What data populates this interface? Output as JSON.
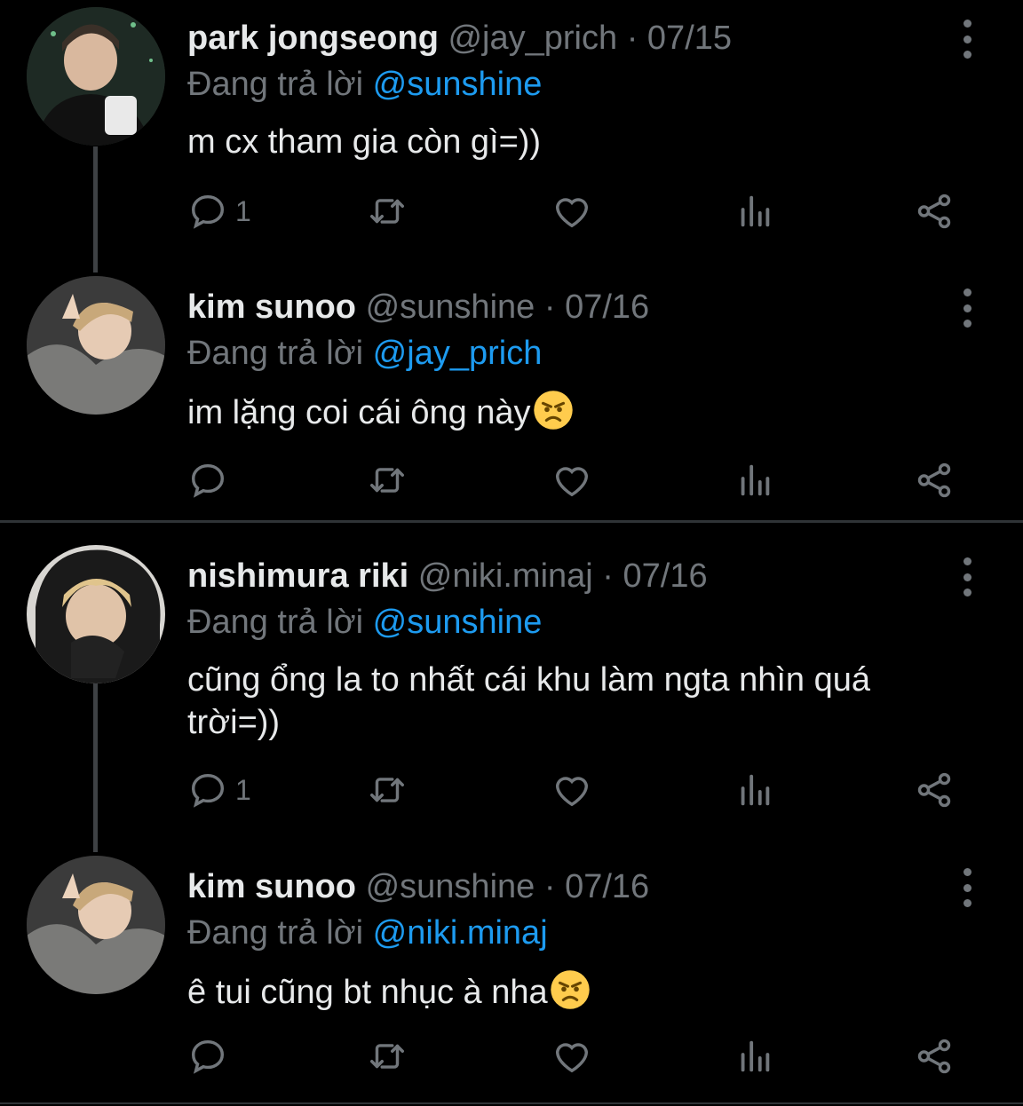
{
  "tweets": [
    {
      "name": "park jongseong",
      "handle": "@jay_prich",
      "separator": "·",
      "date": "07/15",
      "reply_prefix": "Đang trả lời",
      "reply_to": "@sunshine",
      "text": "m cx tham gia còn gì=))",
      "emoji": "",
      "reply_count": "1"
    },
    {
      "name": "kim sunoo",
      "handle": "@sunshine",
      "separator": "·",
      "date": "07/16",
      "reply_prefix": "Đang trả lời",
      "reply_to": "@jay_prich",
      "text": "im lặng coi cái ông này",
      "emoji": "angry-face",
      "reply_count": ""
    },
    {
      "name": "nishimura riki",
      "handle": "@niki.minaj",
      "separator": "·",
      "date": "07/16",
      "reply_prefix": "Đang trả lời",
      "reply_to": "@sunshine",
      "text": "cũng ổng la to nhất cái khu làm ngta nhìn quá trời=))",
      "emoji": "",
      "reply_count": "1"
    },
    {
      "name": "kim sunoo",
      "handle": "@sunshine",
      "separator": "·",
      "date": "07/16",
      "reply_prefix": "Đang trả lời",
      "reply_to": "@niki.minaj",
      "text": "ê tui cũng bt nhục à nha",
      "emoji": "angry-face",
      "reply_count": ""
    }
  ],
  "icons": [
    "reply-icon",
    "retweet-icon",
    "like-icon",
    "views-icon",
    "share-icon",
    "more-icon"
  ],
  "colors": {
    "background": "#000000",
    "text": "#e7e9ea",
    "muted": "#71767b",
    "mention": "#1d9bf0",
    "divider": "#2f3336"
  }
}
